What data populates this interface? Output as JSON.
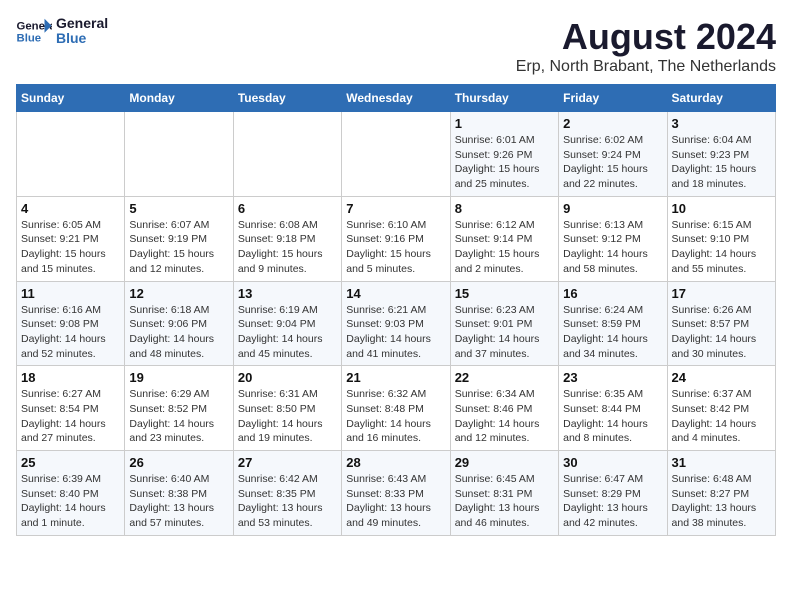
{
  "header": {
    "logo_general": "General",
    "logo_blue": "Blue",
    "main_title": "August 2024",
    "subtitle": "Erp, North Brabant, The Netherlands"
  },
  "calendar": {
    "days_of_week": [
      "Sunday",
      "Monday",
      "Tuesday",
      "Wednesday",
      "Thursday",
      "Friday",
      "Saturday"
    ],
    "weeks": [
      [
        {
          "day": "",
          "info": ""
        },
        {
          "day": "",
          "info": ""
        },
        {
          "day": "",
          "info": ""
        },
        {
          "day": "",
          "info": ""
        },
        {
          "day": "1",
          "info": "Sunrise: 6:01 AM\nSunset: 9:26 PM\nDaylight: 15 hours\nand 25 minutes."
        },
        {
          "day": "2",
          "info": "Sunrise: 6:02 AM\nSunset: 9:24 PM\nDaylight: 15 hours\nand 22 minutes."
        },
        {
          "day": "3",
          "info": "Sunrise: 6:04 AM\nSunset: 9:23 PM\nDaylight: 15 hours\nand 18 minutes."
        }
      ],
      [
        {
          "day": "4",
          "info": "Sunrise: 6:05 AM\nSunset: 9:21 PM\nDaylight: 15 hours\nand 15 minutes."
        },
        {
          "day": "5",
          "info": "Sunrise: 6:07 AM\nSunset: 9:19 PM\nDaylight: 15 hours\nand 12 minutes."
        },
        {
          "day": "6",
          "info": "Sunrise: 6:08 AM\nSunset: 9:18 PM\nDaylight: 15 hours\nand 9 minutes."
        },
        {
          "day": "7",
          "info": "Sunrise: 6:10 AM\nSunset: 9:16 PM\nDaylight: 15 hours\nand 5 minutes."
        },
        {
          "day": "8",
          "info": "Sunrise: 6:12 AM\nSunset: 9:14 PM\nDaylight: 15 hours\nand 2 minutes."
        },
        {
          "day": "9",
          "info": "Sunrise: 6:13 AM\nSunset: 9:12 PM\nDaylight: 14 hours\nand 58 minutes."
        },
        {
          "day": "10",
          "info": "Sunrise: 6:15 AM\nSunset: 9:10 PM\nDaylight: 14 hours\nand 55 minutes."
        }
      ],
      [
        {
          "day": "11",
          "info": "Sunrise: 6:16 AM\nSunset: 9:08 PM\nDaylight: 14 hours\nand 52 minutes."
        },
        {
          "day": "12",
          "info": "Sunrise: 6:18 AM\nSunset: 9:06 PM\nDaylight: 14 hours\nand 48 minutes."
        },
        {
          "day": "13",
          "info": "Sunrise: 6:19 AM\nSunset: 9:04 PM\nDaylight: 14 hours\nand 45 minutes."
        },
        {
          "day": "14",
          "info": "Sunrise: 6:21 AM\nSunset: 9:03 PM\nDaylight: 14 hours\nand 41 minutes."
        },
        {
          "day": "15",
          "info": "Sunrise: 6:23 AM\nSunset: 9:01 PM\nDaylight: 14 hours\nand 37 minutes."
        },
        {
          "day": "16",
          "info": "Sunrise: 6:24 AM\nSunset: 8:59 PM\nDaylight: 14 hours\nand 34 minutes."
        },
        {
          "day": "17",
          "info": "Sunrise: 6:26 AM\nSunset: 8:57 PM\nDaylight: 14 hours\nand 30 minutes."
        }
      ],
      [
        {
          "day": "18",
          "info": "Sunrise: 6:27 AM\nSunset: 8:54 PM\nDaylight: 14 hours\nand 27 minutes."
        },
        {
          "day": "19",
          "info": "Sunrise: 6:29 AM\nSunset: 8:52 PM\nDaylight: 14 hours\nand 23 minutes."
        },
        {
          "day": "20",
          "info": "Sunrise: 6:31 AM\nSunset: 8:50 PM\nDaylight: 14 hours\nand 19 minutes."
        },
        {
          "day": "21",
          "info": "Sunrise: 6:32 AM\nSunset: 8:48 PM\nDaylight: 14 hours\nand 16 minutes."
        },
        {
          "day": "22",
          "info": "Sunrise: 6:34 AM\nSunset: 8:46 PM\nDaylight: 14 hours\nand 12 minutes."
        },
        {
          "day": "23",
          "info": "Sunrise: 6:35 AM\nSunset: 8:44 PM\nDaylight: 14 hours\nand 8 minutes."
        },
        {
          "day": "24",
          "info": "Sunrise: 6:37 AM\nSunset: 8:42 PM\nDaylight: 14 hours\nand 4 minutes."
        }
      ],
      [
        {
          "day": "25",
          "info": "Sunrise: 6:39 AM\nSunset: 8:40 PM\nDaylight: 14 hours\nand 1 minute."
        },
        {
          "day": "26",
          "info": "Sunrise: 6:40 AM\nSunset: 8:38 PM\nDaylight: 13 hours\nand 57 minutes."
        },
        {
          "day": "27",
          "info": "Sunrise: 6:42 AM\nSunset: 8:35 PM\nDaylight: 13 hours\nand 53 minutes."
        },
        {
          "day": "28",
          "info": "Sunrise: 6:43 AM\nSunset: 8:33 PM\nDaylight: 13 hours\nand 49 minutes."
        },
        {
          "day": "29",
          "info": "Sunrise: 6:45 AM\nSunset: 8:31 PM\nDaylight: 13 hours\nand 46 minutes."
        },
        {
          "day": "30",
          "info": "Sunrise: 6:47 AM\nSunset: 8:29 PM\nDaylight: 13 hours\nand 42 minutes."
        },
        {
          "day": "31",
          "info": "Sunrise: 6:48 AM\nSunset: 8:27 PM\nDaylight: 13 hours\nand 38 minutes."
        }
      ]
    ]
  }
}
